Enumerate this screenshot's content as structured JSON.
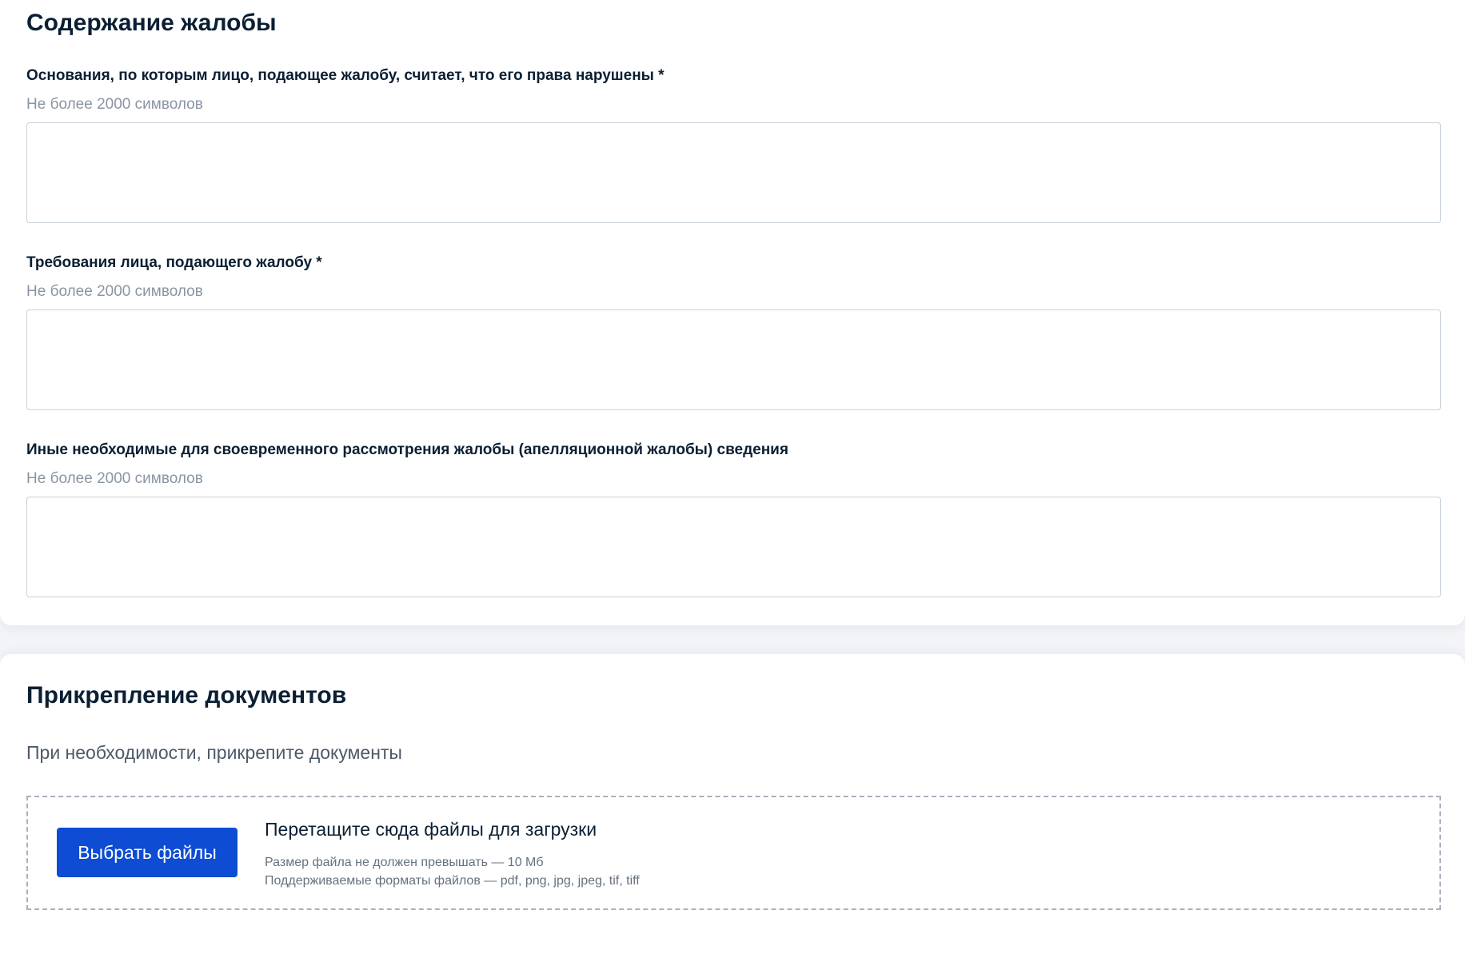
{
  "complaint_section": {
    "title": "Содержание жалобы",
    "fields": [
      {
        "label": "Основания, по которым лицо, подающее жалобу, считает, что его права нарушены *",
        "hint": "Не более 2000 символов",
        "value": ""
      },
      {
        "label": "Требования лица, подающего жалобу *",
        "hint": "Не более 2000 символов",
        "value": ""
      },
      {
        "label": "Иные необходимые для своевременного рассмотрения жалобы (апелляционной жалобы) сведения",
        "hint": "Не более 2000 символов",
        "value": ""
      }
    ]
  },
  "documents_section": {
    "title": "Прикрепление документов",
    "hint": "При необходимости, прикрепите документы",
    "dropzone": {
      "button_label": "Выбрать файлы",
      "title": "Перетащите сюда файлы для загрузки",
      "size_note": "Размер файла не должен превышать — 10 Мб",
      "formats_note": "Поддерживаемые форматы файлов — pdf, png, jpg, jpeg, tif, tiff"
    }
  },
  "colors": {
    "accent": "#0d4cd3",
    "text": "#0b1f33",
    "hint": "#8a95a3",
    "border": "#c9d1da",
    "page_background": "#f3f4f8"
  }
}
